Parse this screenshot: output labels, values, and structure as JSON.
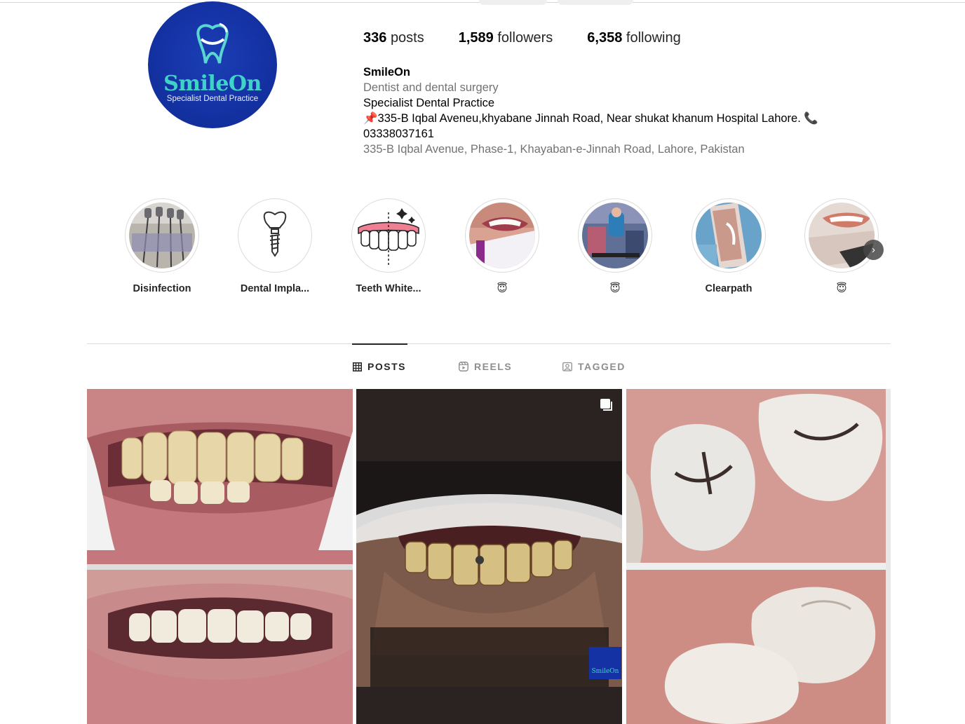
{
  "profile": {
    "avatar": {
      "brand": "SmileOn",
      "tagline": "Specialist Dental Practice"
    },
    "stats": [
      {
        "count": "336",
        "label": "posts"
      },
      {
        "count": "1,589",
        "label": "followers"
      },
      {
        "count": "6,358",
        "label": "following"
      }
    ],
    "bio": {
      "name": "SmileOn",
      "category": "Dentist and dental surgery",
      "line1": "Specialist Dental Practice",
      "line2": "📌335-B Iqbal Aveneu,khyabane Jinnah Road, Near shukat khanum Hospital Lahore. 📞",
      "line3": "03338037161",
      "address": "335-B Iqbal Avenue, Phase-1, Khayaban-e-Jinnah Road, Lahore, Pakistan"
    }
  },
  "highlights": [
    {
      "label": "Disinfection",
      "icon": "dental-tools-photo"
    },
    {
      "label": "Dental Impla...",
      "icon": "implant-icon"
    },
    {
      "label": "Teeth White...",
      "icon": "teeth-whitening-icon"
    },
    {
      "label": "😇",
      "icon": "smile-photo"
    },
    {
      "label": "😇",
      "icon": "clinic-photo"
    },
    {
      "label": "Clearpath",
      "icon": "aligner-box-photo"
    },
    {
      "label": "😇",
      "icon": "aligner-photo"
    }
  ],
  "tabs": [
    {
      "label": "POSTS",
      "icon": "grid-icon",
      "active": true
    },
    {
      "label": "REELS",
      "icon": "reels-icon",
      "active": false
    },
    {
      "label": "TAGGED",
      "icon": "tagged-icon",
      "active": false
    }
  ],
  "posts": [
    {
      "kind": "before-after-smile"
    },
    {
      "kind": "decayed-teeth-photo",
      "multi": true,
      "watermark": "SmileOn"
    },
    {
      "kind": "molar-filling-before-after"
    }
  ],
  "colors": {
    "brand_blue": "#1432a4",
    "brand_teal": "#3fd3c8",
    "muted": "#737373"
  }
}
